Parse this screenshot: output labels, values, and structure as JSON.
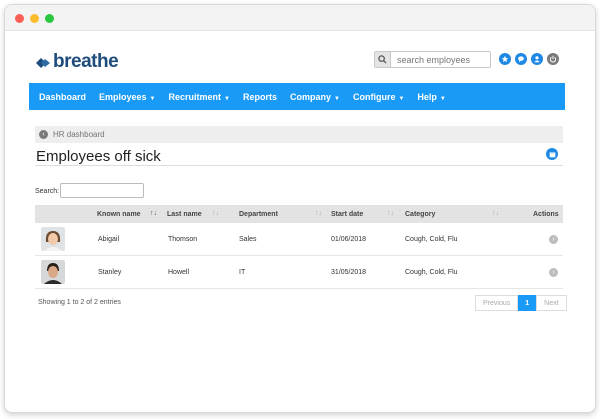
{
  "app": {
    "logo_text": "breathe",
    "brand_color": "#1a9af7"
  },
  "header": {
    "search_placeholder": "search employees",
    "icons": [
      "search-icon",
      "star-icon",
      "chat-icon",
      "user-icon",
      "power-icon"
    ]
  },
  "nav": {
    "items": [
      {
        "label": "Dashboard",
        "dropdown": false
      },
      {
        "label": "Employees",
        "dropdown": true
      },
      {
        "label": "Recruitment",
        "dropdown": true
      },
      {
        "label": "Reports",
        "dropdown": false
      },
      {
        "label": "Company",
        "dropdown": true
      },
      {
        "label": "Configure",
        "dropdown": true
      },
      {
        "label": "Help",
        "dropdown": true
      }
    ]
  },
  "breadcrumb": {
    "label": "HR dashboard"
  },
  "page": {
    "title": "Employees off sick"
  },
  "table": {
    "search_label": "Search:",
    "columns": [
      "Known name",
      "Last name",
      "Department",
      "Start date",
      "Category",
      "Actions"
    ],
    "rows": [
      {
        "known_name": "Abigail",
        "last_name": "Thomson",
        "department": "Sales",
        "start_date": "01/06/2018",
        "category": "Cough, Cold, Flu"
      },
      {
        "known_name": "Stanley",
        "last_name": "Howell",
        "department": "IT",
        "start_date": "31/05/2018",
        "category": "Cough, Cold, Flu"
      }
    ],
    "info": "Showing 1 to 2 of 2 entries",
    "pagination": {
      "previous": "Previous",
      "current": "1",
      "next": "Next"
    }
  }
}
